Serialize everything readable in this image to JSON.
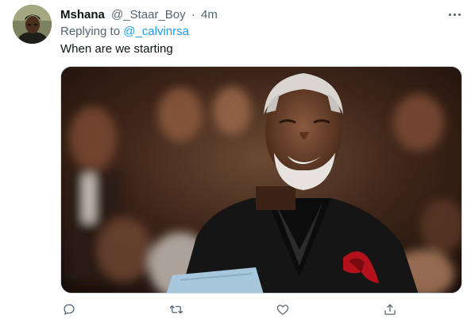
{
  "tweet": {
    "display_name": "Mshana",
    "handle": "@_Staar_Boy",
    "separator": "·",
    "time": "4m",
    "reply_prefix": "Replying to",
    "reply_to": "@_calvinrsa",
    "text": "When are we starting"
  },
  "icons": {
    "more": "more-horizontal-icon",
    "reply": "reply-icon",
    "retweet": "retweet-icon",
    "like": "heart-icon",
    "share": "share-icon"
  },
  "colors": {
    "text_primary": "#0f1419",
    "text_secondary": "#536471",
    "link": "#1d9bf0",
    "border": "#cfd9de"
  }
}
